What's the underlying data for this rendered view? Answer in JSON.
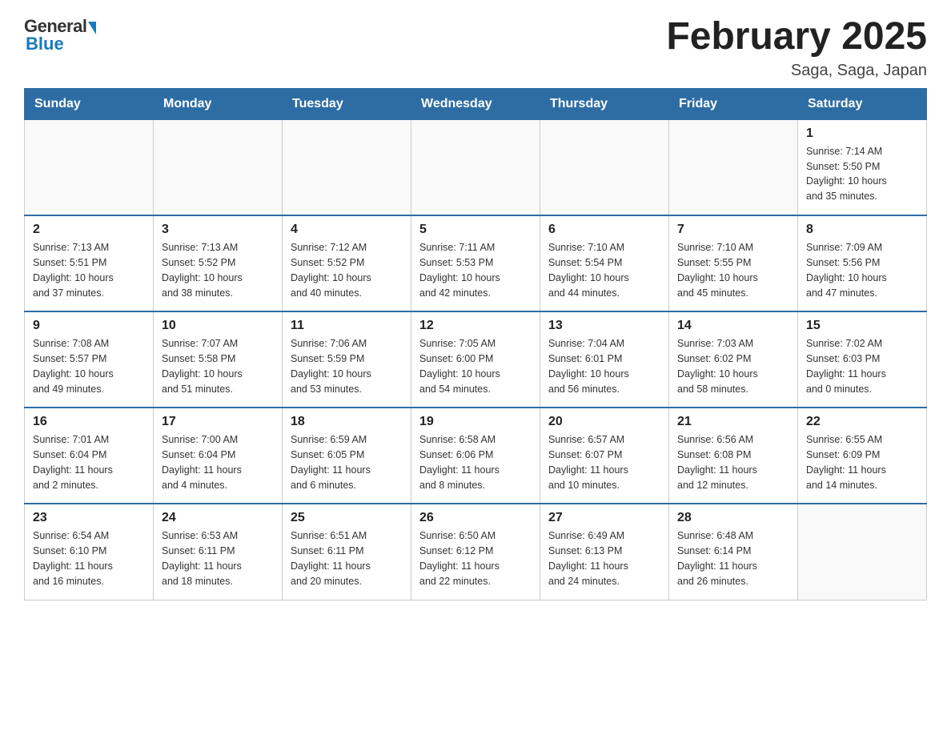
{
  "logo": {
    "general": "General",
    "blue": "Blue"
  },
  "title": "February 2025",
  "subtitle": "Saga, Saga, Japan",
  "days_header": [
    "Sunday",
    "Monday",
    "Tuesday",
    "Wednesday",
    "Thursday",
    "Friday",
    "Saturday"
  ],
  "weeks": [
    [
      {
        "day": "",
        "info": ""
      },
      {
        "day": "",
        "info": ""
      },
      {
        "day": "",
        "info": ""
      },
      {
        "day": "",
        "info": ""
      },
      {
        "day": "",
        "info": ""
      },
      {
        "day": "",
        "info": ""
      },
      {
        "day": "1",
        "info": "Sunrise: 7:14 AM\nSunset: 5:50 PM\nDaylight: 10 hours\nand 35 minutes."
      }
    ],
    [
      {
        "day": "2",
        "info": "Sunrise: 7:13 AM\nSunset: 5:51 PM\nDaylight: 10 hours\nand 37 minutes."
      },
      {
        "day": "3",
        "info": "Sunrise: 7:13 AM\nSunset: 5:52 PM\nDaylight: 10 hours\nand 38 minutes."
      },
      {
        "day": "4",
        "info": "Sunrise: 7:12 AM\nSunset: 5:52 PM\nDaylight: 10 hours\nand 40 minutes."
      },
      {
        "day": "5",
        "info": "Sunrise: 7:11 AM\nSunset: 5:53 PM\nDaylight: 10 hours\nand 42 minutes."
      },
      {
        "day": "6",
        "info": "Sunrise: 7:10 AM\nSunset: 5:54 PM\nDaylight: 10 hours\nand 44 minutes."
      },
      {
        "day": "7",
        "info": "Sunrise: 7:10 AM\nSunset: 5:55 PM\nDaylight: 10 hours\nand 45 minutes."
      },
      {
        "day": "8",
        "info": "Sunrise: 7:09 AM\nSunset: 5:56 PM\nDaylight: 10 hours\nand 47 minutes."
      }
    ],
    [
      {
        "day": "9",
        "info": "Sunrise: 7:08 AM\nSunset: 5:57 PM\nDaylight: 10 hours\nand 49 minutes."
      },
      {
        "day": "10",
        "info": "Sunrise: 7:07 AM\nSunset: 5:58 PM\nDaylight: 10 hours\nand 51 minutes."
      },
      {
        "day": "11",
        "info": "Sunrise: 7:06 AM\nSunset: 5:59 PM\nDaylight: 10 hours\nand 53 minutes."
      },
      {
        "day": "12",
        "info": "Sunrise: 7:05 AM\nSunset: 6:00 PM\nDaylight: 10 hours\nand 54 minutes."
      },
      {
        "day": "13",
        "info": "Sunrise: 7:04 AM\nSunset: 6:01 PM\nDaylight: 10 hours\nand 56 minutes."
      },
      {
        "day": "14",
        "info": "Sunrise: 7:03 AM\nSunset: 6:02 PM\nDaylight: 10 hours\nand 58 minutes."
      },
      {
        "day": "15",
        "info": "Sunrise: 7:02 AM\nSunset: 6:03 PM\nDaylight: 11 hours\nand 0 minutes."
      }
    ],
    [
      {
        "day": "16",
        "info": "Sunrise: 7:01 AM\nSunset: 6:04 PM\nDaylight: 11 hours\nand 2 minutes."
      },
      {
        "day": "17",
        "info": "Sunrise: 7:00 AM\nSunset: 6:04 PM\nDaylight: 11 hours\nand 4 minutes."
      },
      {
        "day": "18",
        "info": "Sunrise: 6:59 AM\nSunset: 6:05 PM\nDaylight: 11 hours\nand 6 minutes."
      },
      {
        "day": "19",
        "info": "Sunrise: 6:58 AM\nSunset: 6:06 PM\nDaylight: 11 hours\nand 8 minutes."
      },
      {
        "day": "20",
        "info": "Sunrise: 6:57 AM\nSunset: 6:07 PM\nDaylight: 11 hours\nand 10 minutes."
      },
      {
        "day": "21",
        "info": "Sunrise: 6:56 AM\nSunset: 6:08 PM\nDaylight: 11 hours\nand 12 minutes."
      },
      {
        "day": "22",
        "info": "Sunrise: 6:55 AM\nSunset: 6:09 PM\nDaylight: 11 hours\nand 14 minutes."
      }
    ],
    [
      {
        "day": "23",
        "info": "Sunrise: 6:54 AM\nSunset: 6:10 PM\nDaylight: 11 hours\nand 16 minutes."
      },
      {
        "day": "24",
        "info": "Sunrise: 6:53 AM\nSunset: 6:11 PM\nDaylight: 11 hours\nand 18 minutes."
      },
      {
        "day": "25",
        "info": "Sunrise: 6:51 AM\nSunset: 6:11 PM\nDaylight: 11 hours\nand 20 minutes."
      },
      {
        "day": "26",
        "info": "Sunrise: 6:50 AM\nSunset: 6:12 PM\nDaylight: 11 hours\nand 22 minutes."
      },
      {
        "day": "27",
        "info": "Sunrise: 6:49 AM\nSunset: 6:13 PM\nDaylight: 11 hours\nand 24 minutes."
      },
      {
        "day": "28",
        "info": "Sunrise: 6:48 AM\nSunset: 6:14 PM\nDaylight: 11 hours\nand 26 minutes."
      },
      {
        "day": "",
        "info": ""
      }
    ]
  ]
}
